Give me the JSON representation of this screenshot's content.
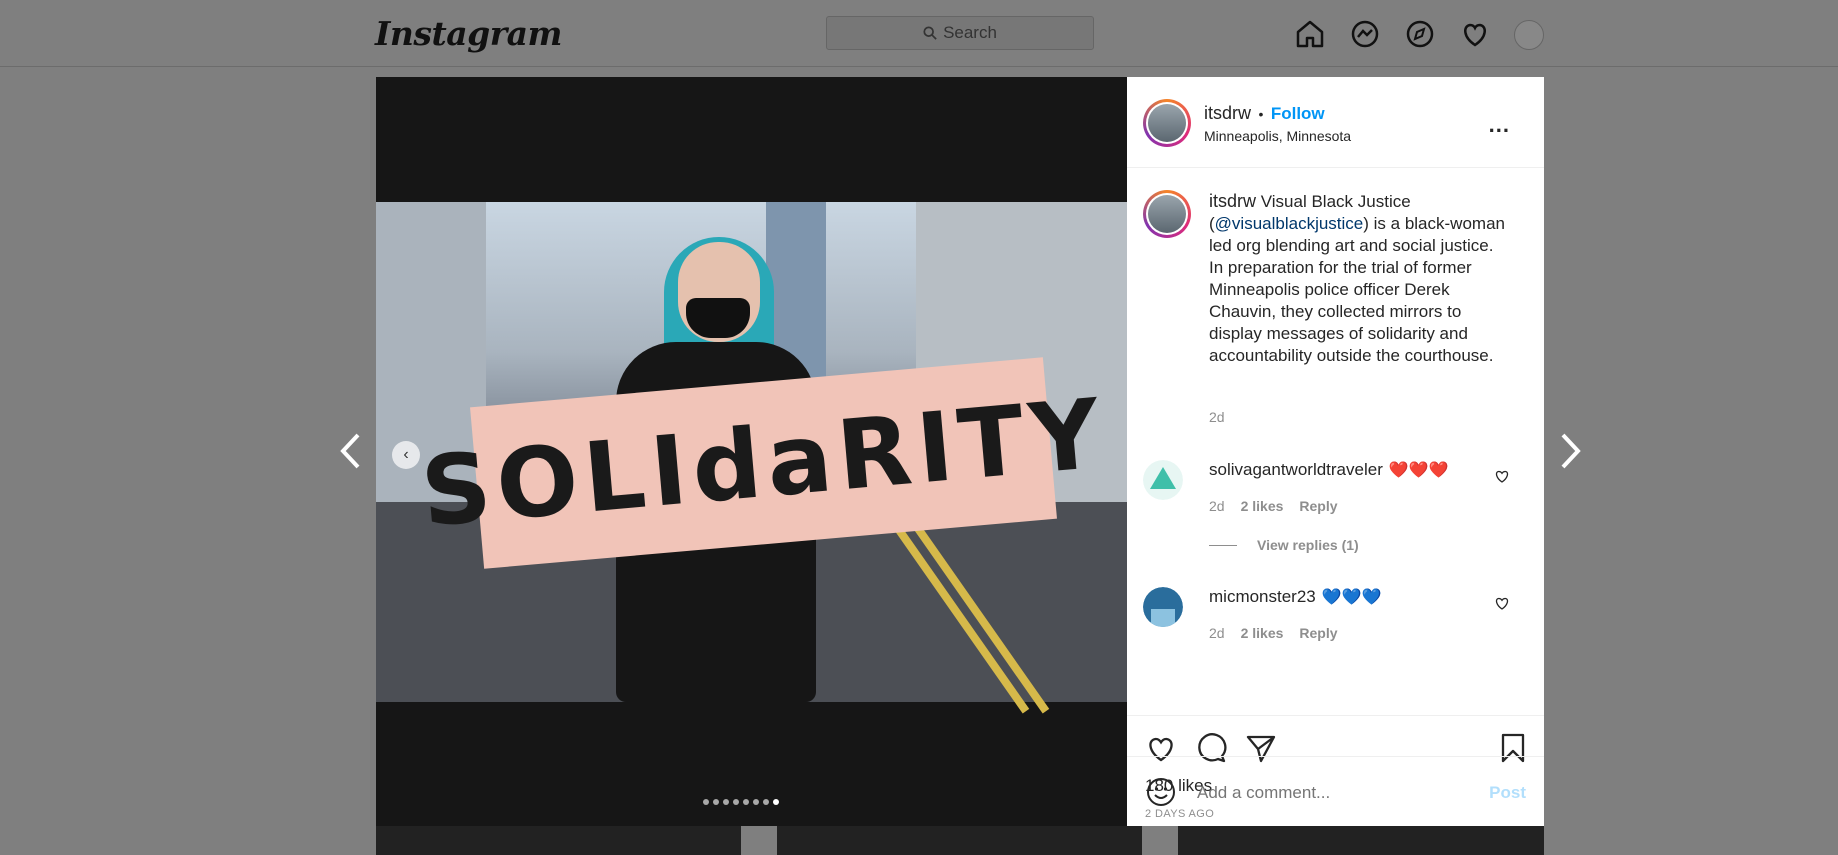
{
  "nav": {
    "logo": "Instagram",
    "search_placeholder": "Search",
    "icons": [
      "home-icon",
      "messenger-icon",
      "explore-icon",
      "activity-heart-icon",
      "profile-avatar"
    ]
  },
  "post": {
    "username": "itsdrw",
    "follow_sep": "•",
    "follow_label": "Follow",
    "location": "Minneapolis, Minnesota",
    "more_label": "...",
    "sign_text": "SOLIdaRITY",
    "carousel": {
      "count": 8,
      "active_index": 7
    },
    "caption": {
      "username": "itsdrw",
      "text_1": "Visual Black Justice (",
      "mention": "@visualblackjustice",
      "text_2": ") is a black-woman led org blending art and social justice. In preparation for the trial of former Minneapolis police officer Derek Chauvin, they collected mirrors to display messages of solidarity and accountability outside the courthouse.",
      "time": "2d"
    },
    "comments": [
      {
        "username": "solivagantworldtraveler",
        "hearts": "❤️❤️❤️",
        "time": "2d",
        "likes": "2 likes",
        "reply": "Reply"
      },
      {
        "username": "micmonster23",
        "hearts": "💙💙💙",
        "time": "2d",
        "likes": "2 likes",
        "reply": "Reply"
      }
    ],
    "view_replies": "View replies (1)",
    "likes": "180 likes",
    "ago": "2 DAYS AGO",
    "comment_placeholder": "Add a comment...",
    "post_label": "Post"
  },
  "colors": {
    "accent": "#0095f6",
    "mention": "#00376b",
    "muted": "#8e8e8e",
    "overlay": "#7f7f7f"
  }
}
